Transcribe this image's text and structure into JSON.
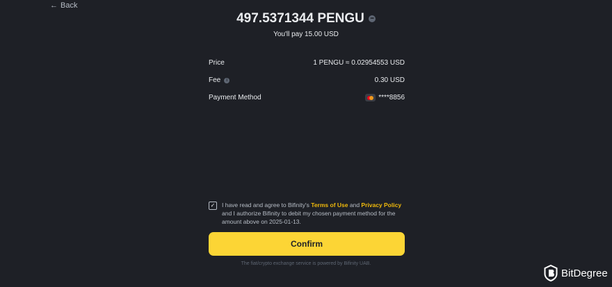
{
  "nav": {
    "back_label": "Back"
  },
  "summary": {
    "amount": "497.5371344 PENGU",
    "pay_text": "You'll pay 15.00 USD"
  },
  "details": {
    "price_label": "Price",
    "price_value": "1 PENGU ≈ 0.02954553 USD",
    "fee_label": "Fee",
    "fee_value": "0.30 USD",
    "payment_label": "Payment Method",
    "payment_value": "****8856"
  },
  "agreement": {
    "checked": true,
    "text_1": "I have read and agree to Bifinity's ",
    "terms_link": "Terms of Use",
    "text_and": " and ",
    "privacy_link": "Privacy Policy",
    "text_2": " and I authorize Bifinity to debit my chosen payment method for the amount above on 2025-01-13."
  },
  "confirm_label": "Confirm",
  "footer_text": "The fiat/crypto exchange service is powered by Bifinity UAB.",
  "watermark": {
    "name": "BitDegree"
  },
  "colors": {
    "background": "#1e2026",
    "accent": "#fcd535",
    "link": "#f0b90b",
    "muted": "#5e6673"
  },
  "icons": {
    "back": "arrow-left-icon",
    "amount_menu": "more-icon",
    "fee_info": "info-icon",
    "payment": "mastercard-icon",
    "checkbox": "checkmark-icon"
  }
}
